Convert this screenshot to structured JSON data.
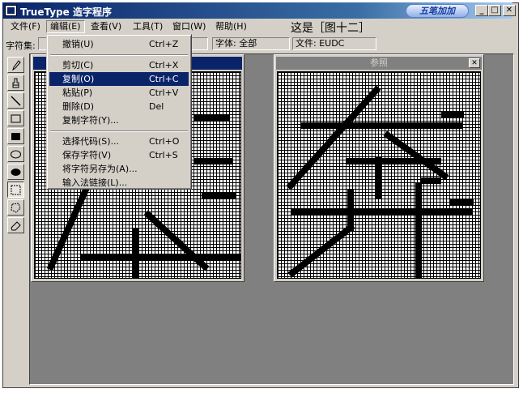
{
  "window": {
    "title": "TrueType 造字程序"
  },
  "ime": {
    "label": "五笔加加"
  },
  "controls": {
    "minimize": "_",
    "maximize": "□",
    "close": "✕"
  },
  "menubar": {
    "items": [
      {
        "label": "文件(F)"
      },
      {
        "label": "编辑(E)"
      },
      {
        "label": "查看(V)"
      },
      {
        "label": "工具(T)"
      },
      {
        "label": "窗口(W)"
      },
      {
        "label": "帮助(H)"
      }
    ],
    "caption": "这是［图十二］"
  },
  "statusbar": {
    "charset_label": "字符集:",
    "font_field": "字体: 全部",
    "file_field": "文件: EUDC"
  },
  "edit_menu": {
    "items": [
      {
        "label": "撤销(U)",
        "shortcut": "Ctrl+Z"
      },
      {
        "label": "剪切(C)",
        "shortcut": "Ctrl+X"
      },
      {
        "label": "复制(O)",
        "shortcut": "Ctrl+C"
      },
      {
        "label": "粘贴(P)",
        "shortcut": "Ctrl+V"
      },
      {
        "label": "删除(D)",
        "shortcut": "Del"
      },
      {
        "label": "复制字符(Y)...",
        "shortcut": ""
      },
      {
        "label": "选择代码(S)...",
        "shortcut": "Ctrl+O"
      },
      {
        "label": "保存字符(V)",
        "shortcut": "Ctrl+S"
      },
      {
        "label": "将字符另存为(A)...",
        "shortcut": ""
      },
      {
        "label": "输入法链接(L)...",
        "shortcut": ""
      }
    ],
    "highlighted_index": 2
  },
  "reference_panel": {
    "title": "参照",
    "close": "✕"
  },
  "toolbox": {
    "tools": [
      "pencil-icon",
      "brush-icon",
      "line-icon",
      "hollow-rectangle-icon",
      "filled-rectangle-icon",
      "hollow-ellipse-icon",
      "filled-ellipse-icon",
      "rectangular-select-icon",
      "freeform-select-icon",
      "eraser-icon"
    ],
    "selected_index": 7
  },
  "colors": {
    "title_active": "#0a246a",
    "face": "#d4d0c8",
    "workspace": "#808080"
  }
}
